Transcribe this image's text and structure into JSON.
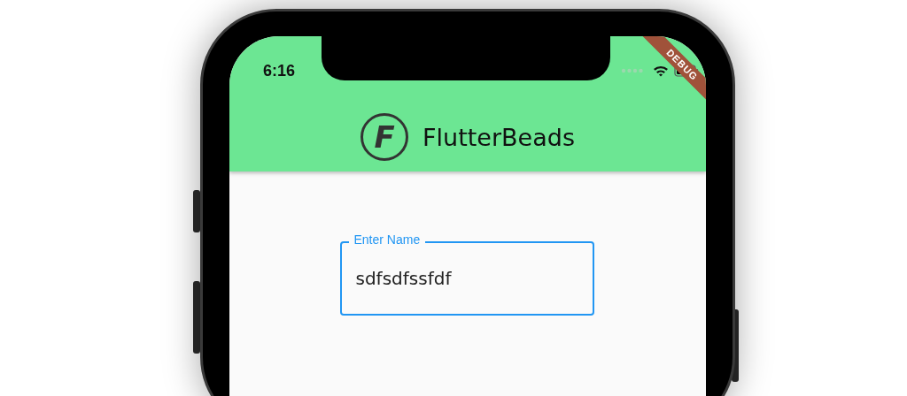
{
  "status_bar": {
    "time": "6:16"
  },
  "debug_banner": {
    "label": "DEBUG"
  },
  "app_bar": {
    "logo_letter": "F",
    "title": "FlutterBeads"
  },
  "name_field": {
    "label": "Enter Name",
    "value": "sdfsdfssfdf",
    "focused": true
  }
}
